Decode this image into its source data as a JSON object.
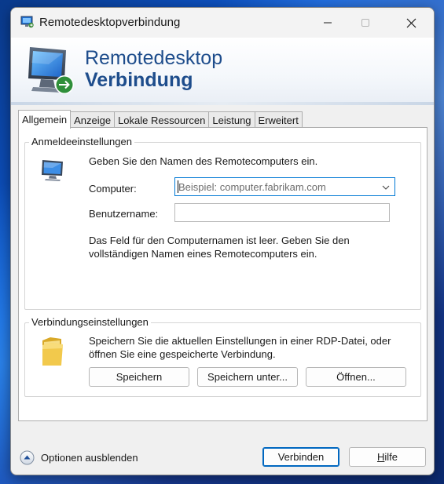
{
  "window": {
    "title": "Remotedesktopverbindung",
    "minimize_icon": "minimize-icon",
    "maximize_icon": "maximize-icon",
    "close_icon": "close-icon"
  },
  "banner": {
    "line1": "Remotedesktop",
    "line2": "Verbindung",
    "accent_color": "#1e4d8c"
  },
  "tabs": [
    {
      "label": "Allgemein",
      "active": true
    },
    {
      "label": "Anzeige",
      "active": false
    },
    {
      "label": "Lokale Ressourcen",
      "active": false
    },
    {
      "label": "Leistung",
      "active": false
    },
    {
      "label": "Erweitert",
      "active": false
    }
  ],
  "logon": {
    "legend": "Anmeldeeinstellungen",
    "intro": "Geben Sie den Namen des Remotecomputers ein.",
    "computer_label": "Computer:",
    "computer_value": "",
    "computer_placeholder": "Beispiel: computer.fabrikam.com",
    "username_label": "Benutzername:",
    "username_value": "",
    "info": "Das Feld für den Computernamen ist leer. Geben Sie den vollständigen Namen eines Remotecomputers ein."
  },
  "connection": {
    "legend": "Verbindungseinstellungen",
    "text": "Speichern Sie die aktuellen Einstellungen in einer RDP-Datei, oder öffnen Sie eine gespeicherte Verbindung.",
    "save_label": "Speichern",
    "save_as_label": "Speichern unter...",
    "open_label": "Öffnen..."
  },
  "footer": {
    "options_label": "Optionen ausblenden",
    "connect_label": "Verbinden",
    "help_prefix": "",
    "help_underlined": "H",
    "help_rest": "ilfe"
  }
}
